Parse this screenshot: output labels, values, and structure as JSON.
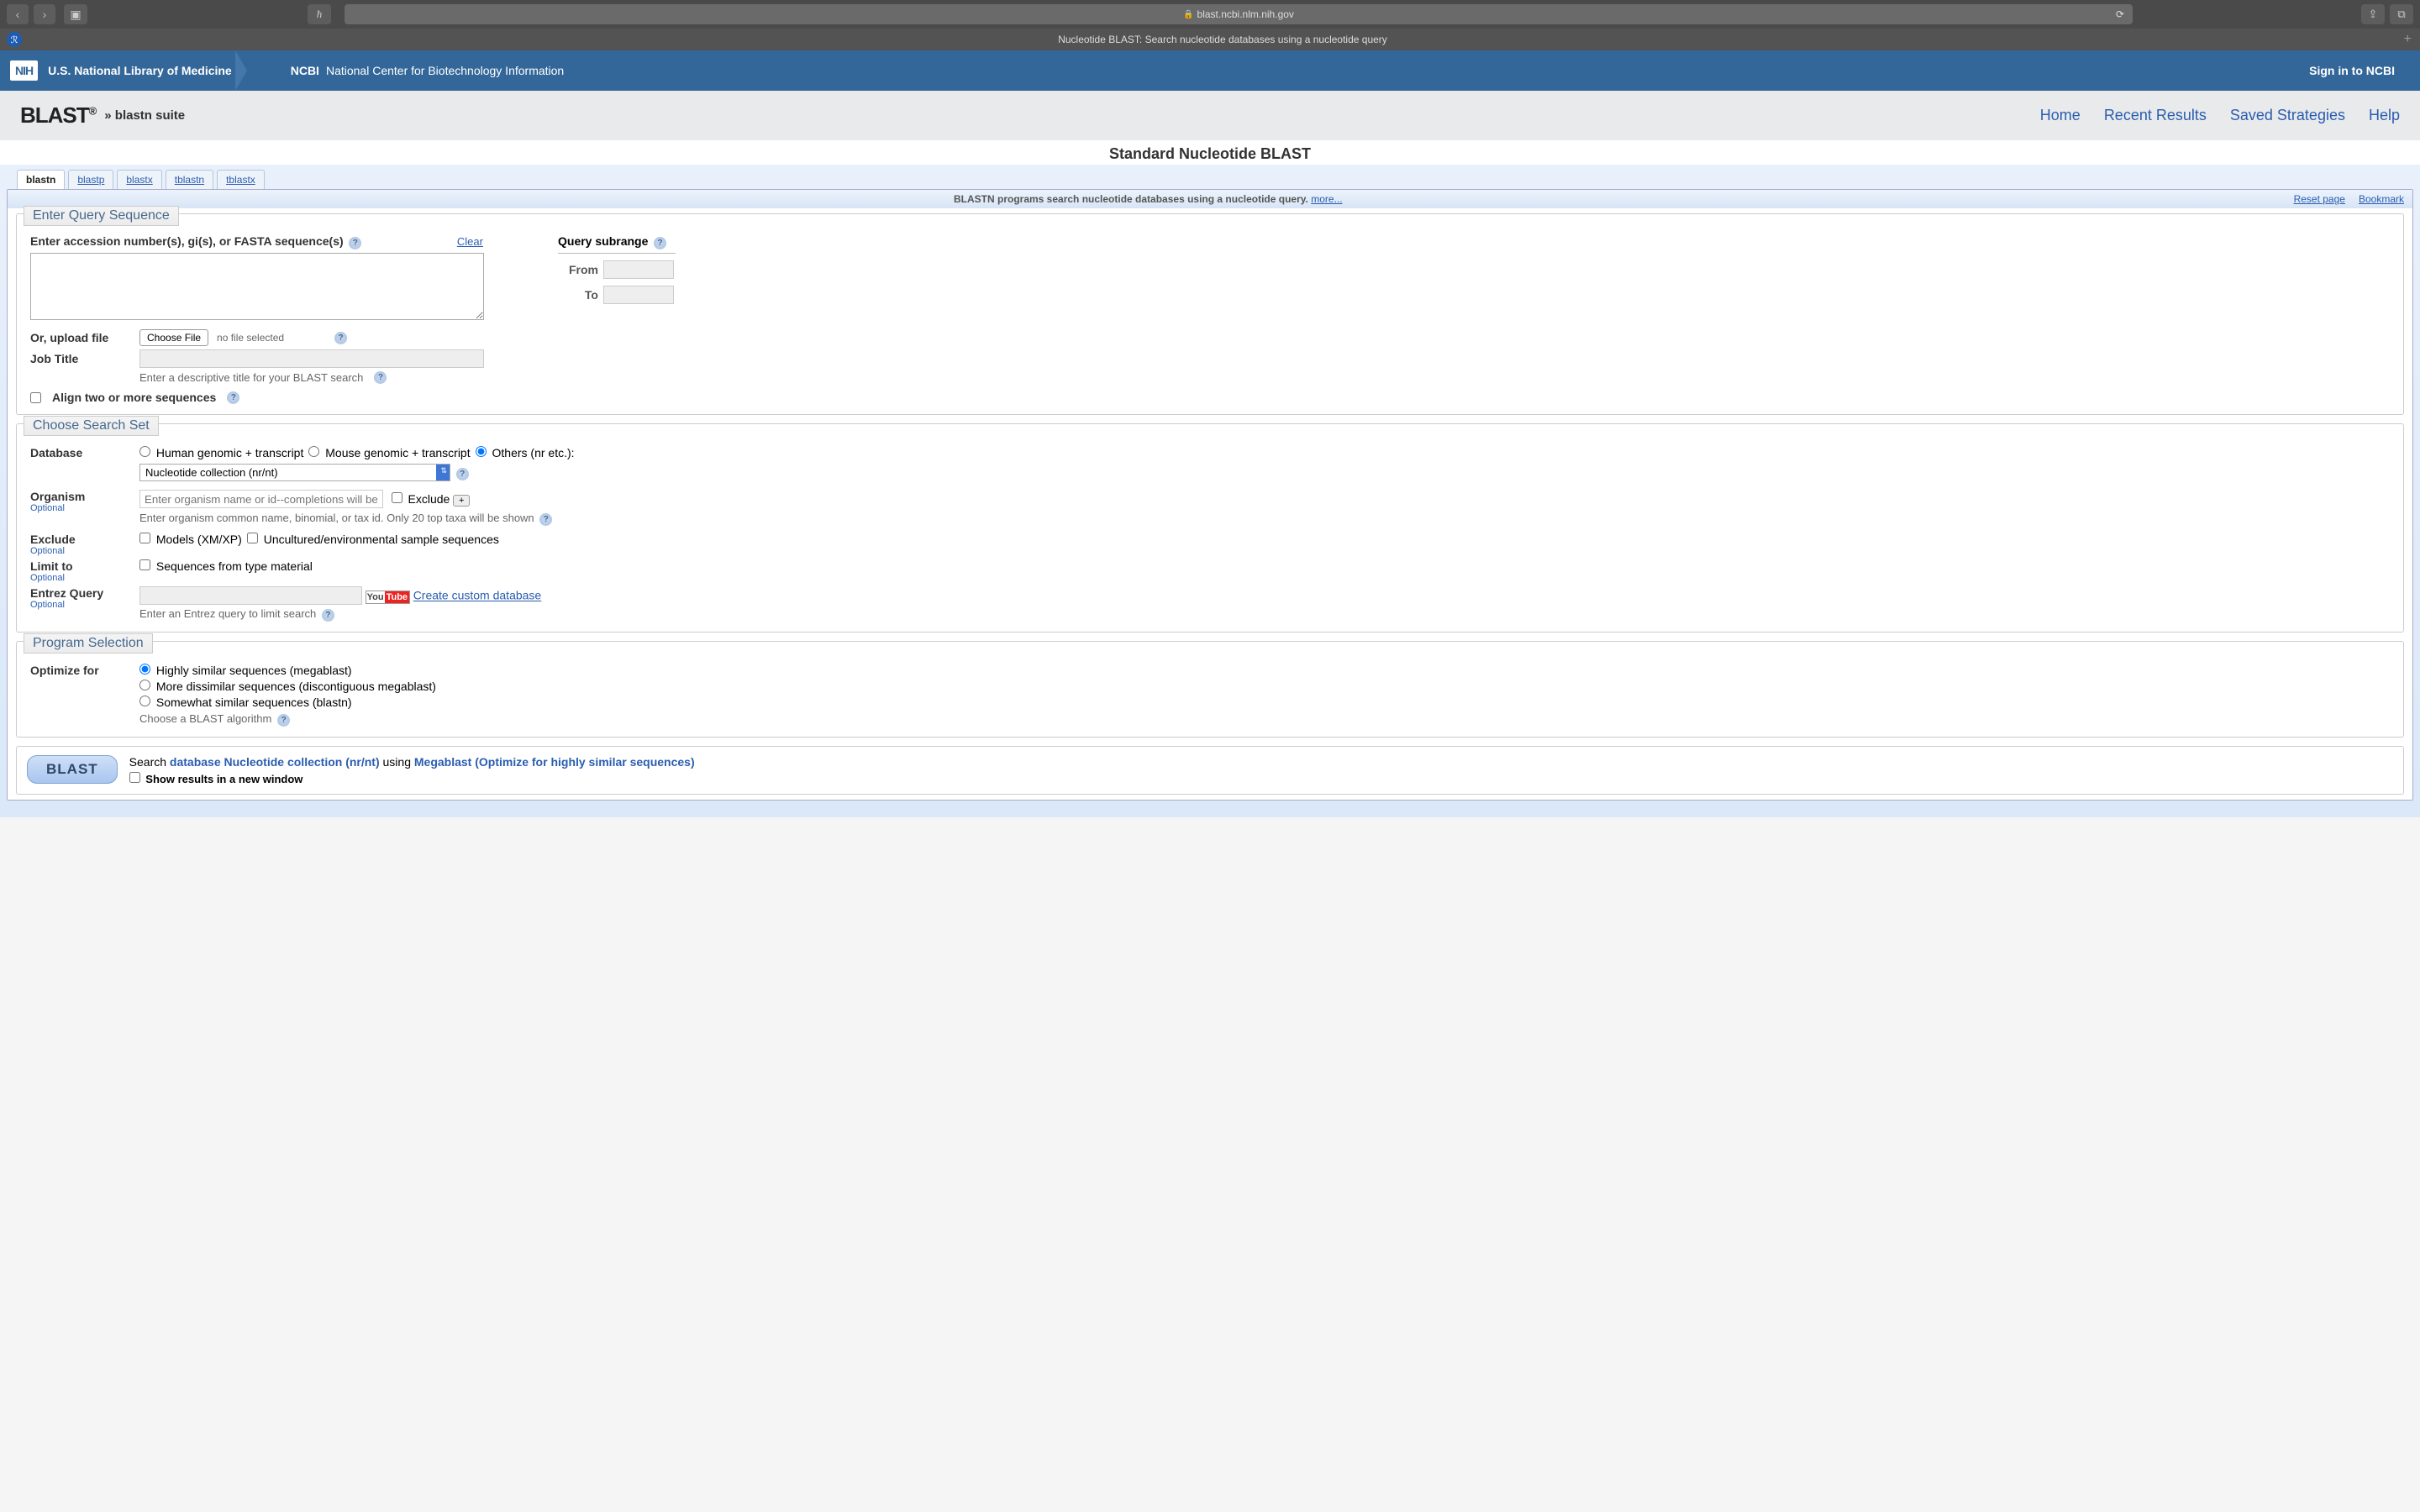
{
  "browser": {
    "url": "blast.ncbi.nlm.nih.gov",
    "tab_title": "Nucleotide BLAST: Search nucleotide databases using a nucleotide query"
  },
  "ncbi_header": {
    "nih": "NIH",
    "nlm": "U.S. National Library of Medicine",
    "ncbi_label": "NCBI",
    "ncbi_full": "National Center for Biotechnology Information",
    "signin": "Sign in to NCBI"
  },
  "blast_hdr": {
    "logo": "BLAST",
    "suite": "» blastn suite",
    "nav": {
      "home": "Home",
      "recent": "Recent Results",
      "saved": "Saved Strategies",
      "help": "Help"
    }
  },
  "page_title": "Standard Nucleotide BLAST",
  "tabs": {
    "blastn": "blastn",
    "blastp": "blastp",
    "blastx": "blastx",
    "tblastn": "tblastn",
    "tblastx": "tblastx"
  },
  "intro": {
    "text": "BLASTN programs search nucleotide databases using a nucleotide query.",
    "more": "more...",
    "reset": "Reset page",
    "bookmark": "Bookmark"
  },
  "query": {
    "legend": "Enter Query Sequence",
    "accession_label": "Enter accession number(s), gi(s), or FASTA sequence(s)",
    "clear": "Clear",
    "upload_label": "Or, upload file",
    "choose_file": "Choose File",
    "no_file": "no file selected",
    "job_title_label": "Job Title",
    "job_title_hint": "Enter a descriptive title for your BLAST search",
    "align_two": "Align two or more sequences",
    "subrange_label": "Query subrange",
    "from": "From",
    "to": "To"
  },
  "searchset": {
    "legend": "Choose Search Set",
    "database_label": "Database",
    "db_opt_human": "Human genomic + transcript",
    "db_opt_mouse": "Mouse genomic + transcript",
    "db_opt_others": "Others (nr etc.):",
    "db_select": "Nucleotide collection (nr/nt)",
    "organism_label": "Organism",
    "optional": "Optional",
    "organism_placeholder": "Enter organism name or id--completions will be suggested",
    "exclude_cb": "Exclude",
    "organism_hint": "Enter organism common name, binomial, or tax id. Only 20 top taxa will be shown",
    "exclude_label": "Exclude",
    "exclude_models": "Models (XM/XP)",
    "exclude_uncultured": "Uncultured/environmental sample sequences",
    "limit_label": "Limit to",
    "limit_seq": "Sequences from type material",
    "entrez_label": "Entrez Query",
    "entrez_create": "Create custom database",
    "entrez_hint": "Enter an Entrez query to limit search"
  },
  "program": {
    "legend": "Program Selection",
    "optimize_label": "Optimize for",
    "opt_mega": "Highly similar sequences (megablast)",
    "opt_disc": "More dissimilar sequences (discontiguous megablast)",
    "opt_blastn": "Somewhat similar sequences (blastn)",
    "hint": "Choose a BLAST algorithm"
  },
  "submit": {
    "button": "BLAST",
    "search_word": "Search",
    "db_desc": "database Nucleotide collection (nr/nt)",
    "using": "using",
    "prog_desc": "Megablast (Optimize for highly similar sequences)",
    "new_window": "Show results in a new window"
  }
}
